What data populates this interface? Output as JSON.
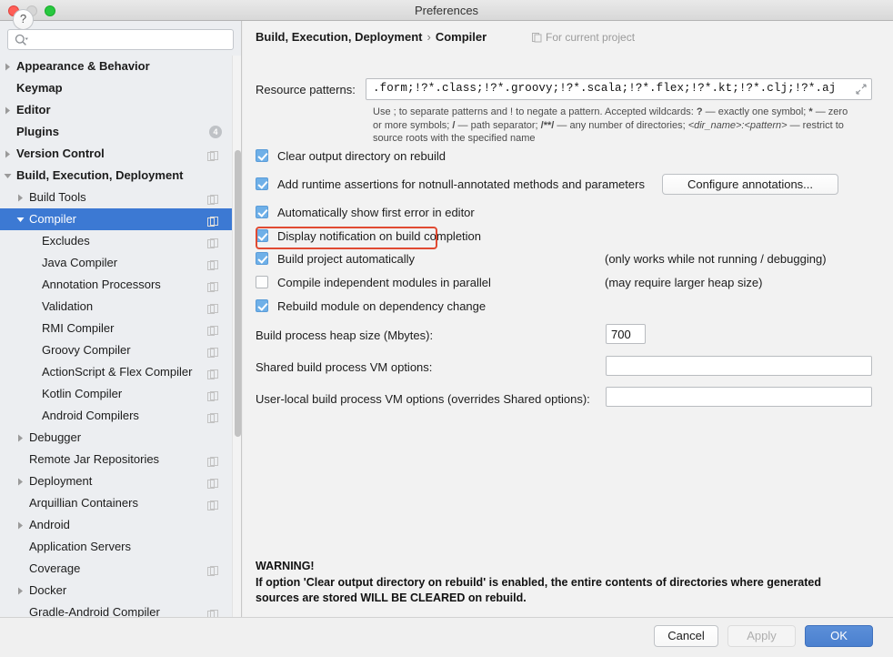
{
  "window": {
    "title": "Preferences",
    "traffic_lights": [
      "close",
      "minimize",
      "zoom"
    ]
  },
  "sidebar": {
    "search": {
      "value": "",
      "placeholder": ""
    },
    "items": [
      {
        "label": "Appearance & Behavior",
        "indent": 0,
        "arrow": "collapsed",
        "bold": true,
        "project_icon": false,
        "badge": null,
        "selected": false
      },
      {
        "label": "Keymap",
        "indent": 0,
        "arrow": "none",
        "bold": true,
        "project_icon": false,
        "badge": null,
        "selected": false
      },
      {
        "label": "Editor",
        "indent": 0,
        "arrow": "collapsed",
        "bold": true,
        "project_icon": false,
        "badge": null,
        "selected": false
      },
      {
        "label": "Plugins",
        "indent": 0,
        "arrow": "none",
        "bold": true,
        "project_icon": false,
        "badge": "4",
        "selected": false
      },
      {
        "label": "Version Control",
        "indent": 0,
        "arrow": "collapsed",
        "bold": true,
        "project_icon": true,
        "badge": null,
        "selected": false
      },
      {
        "label": "Build, Execution, Deployment",
        "indent": 0,
        "arrow": "expanded",
        "bold": true,
        "project_icon": false,
        "badge": null,
        "selected": false
      },
      {
        "label": "Build Tools",
        "indent": 1,
        "arrow": "collapsed",
        "bold": false,
        "project_icon": true,
        "badge": null,
        "selected": false
      },
      {
        "label": "Compiler",
        "indent": 1,
        "arrow": "expanded",
        "bold": false,
        "project_icon": true,
        "badge": null,
        "selected": true
      },
      {
        "label": "Excludes",
        "indent": 2,
        "arrow": "none",
        "bold": false,
        "project_icon": true,
        "badge": null,
        "selected": false
      },
      {
        "label": "Java Compiler",
        "indent": 2,
        "arrow": "none",
        "bold": false,
        "project_icon": true,
        "badge": null,
        "selected": false
      },
      {
        "label": "Annotation Processors",
        "indent": 2,
        "arrow": "none",
        "bold": false,
        "project_icon": true,
        "badge": null,
        "selected": false
      },
      {
        "label": "Validation",
        "indent": 2,
        "arrow": "none",
        "bold": false,
        "project_icon": true,
        "badge": null,
        "selected": false
      },
      {
        "label": "RMI Compiler",
        "indent": 2,
        "arrow": "none",
        "bold": false,
        "project_icon": true,
        "badge": null,
        "selected": false
      },
      {
        "label": "Groovy Compiler",
        "indent": 2,
        "arrow": "none",
        "bold": false,
        "project_icon": true,
        "badge": null,
        "selected": false
      },
      {
        "label": "ActionScript & Flex Compiler",
        "indent": 2,
        "arrow": "none",
        "bold": false,
        "project_icon": true,
        "badge": null,
        "selected": false
      },
      {
        "label": "Kotlin Compiler",
        "indent": 2,
        "arrow": "none",
        "bold": false,
        "project_icon": true,
        "badge": null,
        "selected": false
      },
      {
        "label": "Android Compilers",
        "indent": 2,
        "arrow": "none",
        "bold": false,
        "project_icon": true,
        "badge": null,
        "selected": false
      },
      {
        "label": "Debugger",
        "indent": 1,
        "arrow": "collapsed",
        "bold": false,
        "project_icon": false,
        "badge": null,
        "selected": false
      },
      {
        "label": "Remote Jar Repositories",
        "indent": 1,
        "arrow": "none",
        "bold": false,
        "project_icon": true,
        "badge": null,
        "selected": false
      },
      {
        "label": "Deployment",
        "indent": 1,
        "arrow": "collapsed",
        "bold": false,
        "project_icon": true,
        "badge": null,
        "selected": false
      },
      {
        "label": "Arquillian Containers",
        "indent": 1,
        "arrow": "none",
        "bold": false,
        "project_icon": true,
        "badge": null,
        "selected": false
      },
      {
        "label": "Android",
        "indent": 1,
        "arrow": "collapsed",
        "bold": false,
        "project_icon": false,
        "badge": null,
        "selected": false
      },
      {
        "label": "Application Servers",
        "indent": 1,
        "arrow": "none",
        "bold": false,
        "project_icon": false,
        "badge": null,
        "selected": false
      },
      {
        "label": "Coverage",
        "indent": 1,
        "arrow": "none",
        "bold": false,
        "project_icon": true,
        "badge": null,
        "selected": false
      },
      {
        "label": "Docker",
        "indent": 1,
        "arrow": "collapsed",
        "bold": false,
        "project_icon": false,
        "badge": null,
        "selected": false
      },
      {
        "label": "Gradle-Android Compiler",
        "indent": 1,
        "arrow": "none",
        "bold": false,
        "project_icon": true,
        "badge": null,
        "selected": false
      }
    ]
  },
  "main": {
    "breadcrumb": {
      "parent": "Build, Execution, Deployment",
      "separator": "›",
      "current": "Compiler"
    },
    "for_current_project": "For current project",
    "resource_patterns": {
      "label": "Resource patterns:",
      "value": "!?*.java;!?*.form;!?*.class;!?*.groovy;!?*.scala;!?*.flex;!?*.kt;!?*.clj;!?*.aj",
      "visible_value": ".form;!?*.class;!?*.groovy;!?*.scala;!?*.flex;!?*.kt;!?*.clj;!?*.aj"
    },
    "hint": {
      "p1": "Use ; to separate patterns and ! to negate a pattern. Accepted wildcards: ",
      "b1": "?",
      "p2": " — exactly one symbol; ",
      "b2": "*",
      "p3": " — zero or more symbols; ",
      "b3": "/",
      "p4": " — path separator; ",
      "b4": "/**/",
      "p5": " — any number of directories; ",
      "i1": "<dir_name>:<pattern>",
      "p6": " — restrict to source roots with the specified name"
    },
    "checkboxes": [
      {
        "label": "Clear output directory on rebuild",
        "checked": true,
        "note": ""
      },
      {
        "label": "Add runtime assertions for notnull-annotated methods and parameters",
        "checked": true,
        "note": ""
      },
      {
        "label": "Automatically show first error in editor",
        "checked": true,
        "note": ""
      },
      {
        "label": "Display notification on build completion",
        "checked": true,
        "note": ""
      },
      {
        "label": "Build project automatically",
        "checked": true,
        "note": "(only works while not running / debugging)"
      },
      {
        "label": "Compile independent modules in parallel",
        "checked": false,
        "note": "(may require larger heap size)"
      },
      {
        "label": "Rebuild module on dependency change",
        "checked": true,
        "note": ""
      }
    ],
    "configure_annotations_button": "Configure annotations...",
    "fields": [
      {
        "label": "Build process heap size (Mbytes):",
        "value": "700",
        "placeholder": ""
      },
      {
        "label": "Shared build process VM options:",
        "value": "",
        "placeholder": ""
      },
      {
        "label": "User-local build process VM options (overrides Shared options):",
        "value": "",
        "placeholder": ""
      }
    ],
    "warning": {
      "title": "WARNING!",
      "line1": "If option 'Clear output directory on rebuild' is enabled, the entire contents of directories where generated",
      "line2": "sources are stored WILL BE CLEARED on rebuild."
    },
    "highlight_color": "#e04a32"
  },
  "footer": {
    "help": "?",
    "cancel": "Cancel",
    "apply": "Apply",
    "ok": "OK",
    "apply_disabled": true,
    "primary_color": "#4b80cf"
  }
}
